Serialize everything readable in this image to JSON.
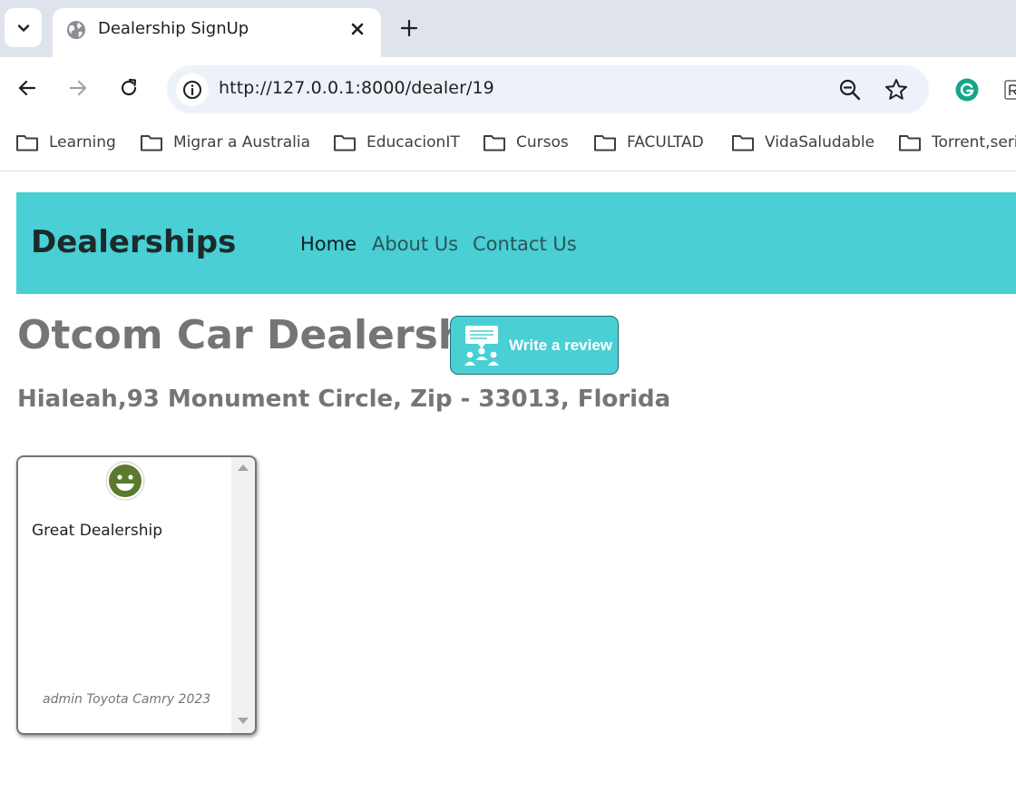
{
  "browser": {
    "tab_title": "Dealership SignUp",
    "url": "http://127.0.0.1:8000/dealer/19",
    "bookmarks": [
      "Learning",
      "Migrar a Australia",
      "EducacionIT",
      "Cursos",
      "FACULTAD",
      "VidaSaludable",
      "Torrent,series"
    ]
  },
  "navbar": {
    "brand": "Dealerships",
    "links": [
      "Home",
      "About Us",
      "Contact Us"
    ],
    "color": "#49cfd4"
  },
  "dealer": {
    "name": "Otcom Car Dealership",
    "review_button_label": "Write a review",
    "address": "Hialeah,93 Monument Circle, Zip - 33013, Florida"
  },
  "reviews": [
    {
      "sentiment": "positive",
      "sentiment_icon": "smiley-face-icon",
      "text": "Great Dealership",
      "reviewer": "admin Toyota Camry 2023"
    }
  ]
}
